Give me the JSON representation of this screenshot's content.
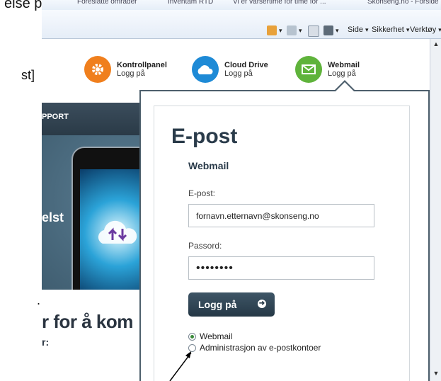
{
  "doc": {
    "top_fragment": "else pr emer",
    "left_bracket": "st]",
    "left_dot": ".",
    "mid_fragment": "elst",
    "heading_fragment": "r for å kom",
    "sub_fragment": "r:"
  },
  "favorites": {
    "items": [
      "Foreslåtte områder",
      "Inventam RTD",
      "Vi er vårsertime for time for ...",
      "Skonseng.no - Forside"
    ]
  },
  "command_bar": {
    "side_label": "Side",
    "security_label": "Sikkerhet",
    "tools_label": "Verktøy",
    "help_label": "?"
  },
  "site": {
    "nav_item": "PPORT",
    "services": [
      {
        "title": "Kontrollpanel",
        "sub": "Logg på"
      },
      {
        "title": "Cloud Drive",
        "sub": "Logg på"
      },
      {
        "title": "Webmail",
        "sub": "Logg på"
      }
    ],
    "colors": {
      "kontrollpanel": "#f07f1d",
      "cloud": "#1e8ad6",
      "webmail": "#5fb33b",
      "accent_green": "#8cc63f"
    }
  },
  "login": {
    "title": "E-post",
    "subtitle": "Webmail",
    "email_label": "E-post:",
    "email_value": "fornavn.etternavn@skonseng.no",
    "password_label": "Passord:",
    "password_value": "••••••••",
    "button_label": "Logg på",
    "radio_webmail": "Webmail",
    "radio_admin": "Administrasjon av e-postkontoer",
    "selected": "Webmail"
  }
}
